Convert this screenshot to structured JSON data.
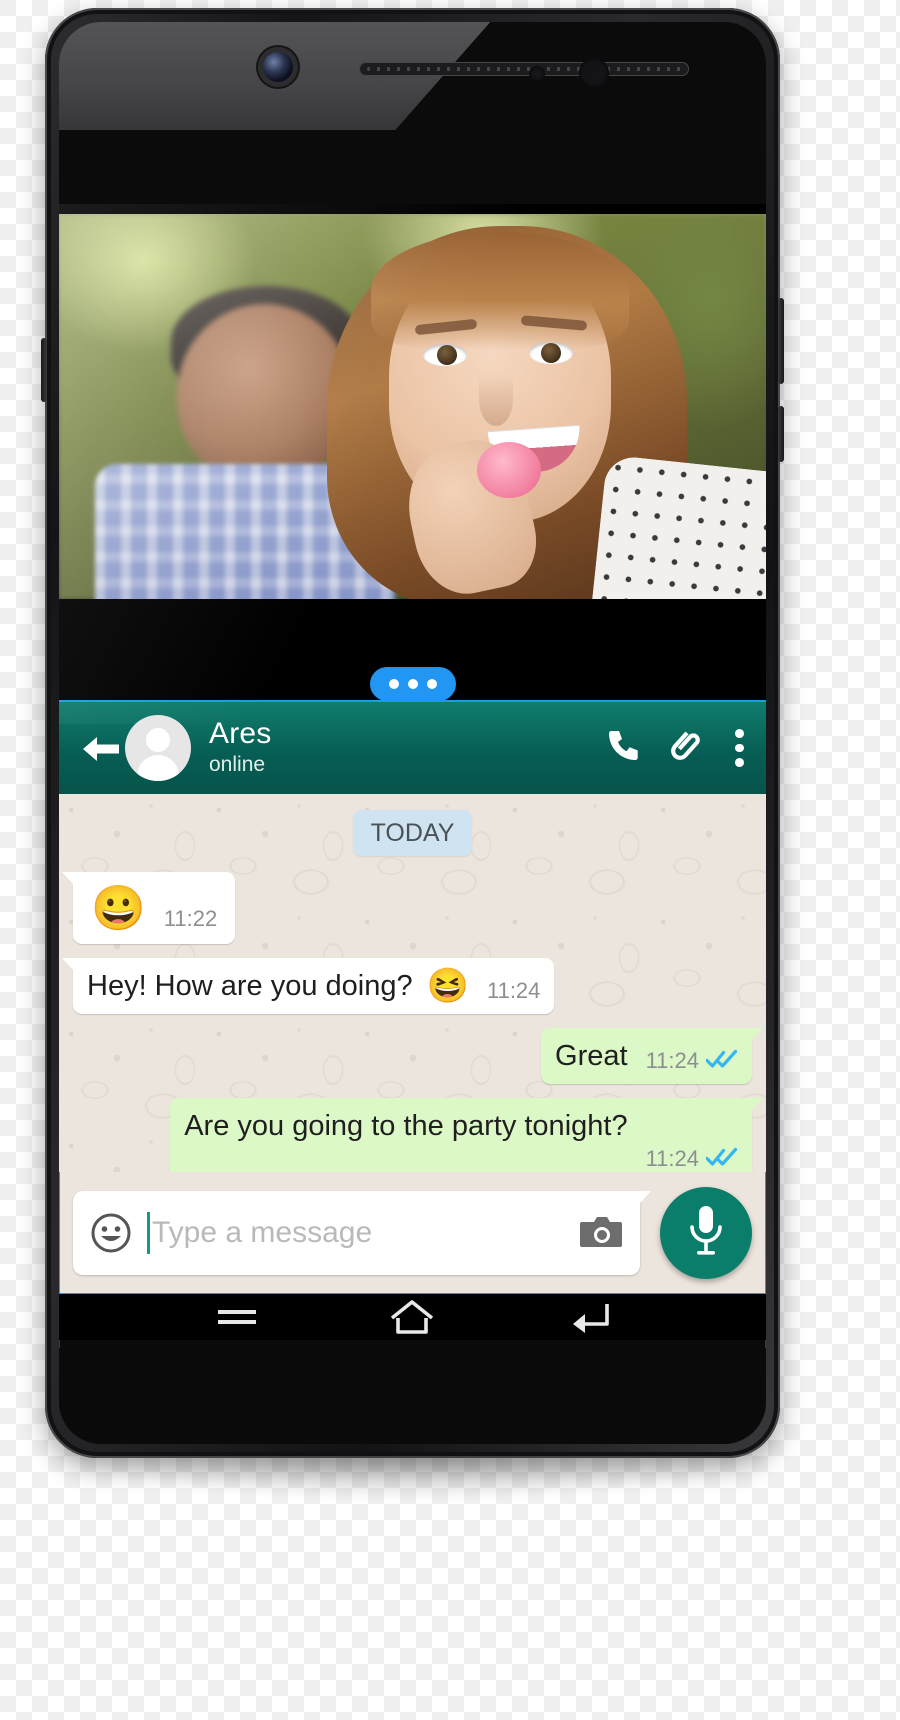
{
  "device": {
    "name": "android-smartphone",
    "hardware": {
      "front_camera": "camera-icon",
      "earpiece": "speaker-grille",
      "proximity_sensor": "sensor-icon"
    }
  },
  "wallpaper": {
    "photo_alt": "woman-eating-macaron-with-man-in-background"
  },
  "selection": {
    "accent_color": "#2196f3",
    "handle_icon": "drag-handle-dots"
  },
  "whatsapp": {
    "header": {
      "back_icon": "back-arrow-icon",
      "avatar_icon": "contact-avatar-icon",
      "contact_name": "Ares",
      "contact_status": "online",
      "call_icon": "phone-icon",
      "attach_icon": "paperclip-icon",
      "overflow_icon": "more-vertical-icon",
      "background_color": "#075e54"
    },
    "chat": {
      "day_divider": "TODAY",
      "incoming_bubble_color": "#ffffff",
      "outgoing_bubble_color": "#dcf8c6",
      "read_tick_color": "#34b7f1",
      "messages": [
        {
          "direction": "in",
          "text": "",
          "emoji": "😀",
          "emoji_only": true,
          "time": "11:22",
          "status": ""
        },
        {
          "direction": "in",
          "text": "Hey! How are you doing?",
          "emoji": "😆",
          "emoji_only": false,
          "time": "11:24",
          "status": ""
        },
        {
          "direction": "out",
          "text": "Great",
          "emoji": "",
          "emoji_only": false,
          "time": "11:24",
          "status": "read"
        },
        {
          "direction": "out",
          "text": "Are you going to the party tonight?",
          "emoji": "",
          "emoji_only": false,
          "time": "11:24",
          "status": "read"
        }
      ]
    },
    "composer": {
      "emoji_icon": "smiley-icon",
      "placeholder": "Type a message",
      "value": "",
      "camera_icon": "camera-icon",
      "mic_icon": "microphone-icon",
      "mic_button_color": "#0a7d6b"
    }
  },
  "navbar": {
    "menu_icon": "menu-icon",
    "home_icon": "home-icon",
    "back_icon": "back-icon"
  }
}
